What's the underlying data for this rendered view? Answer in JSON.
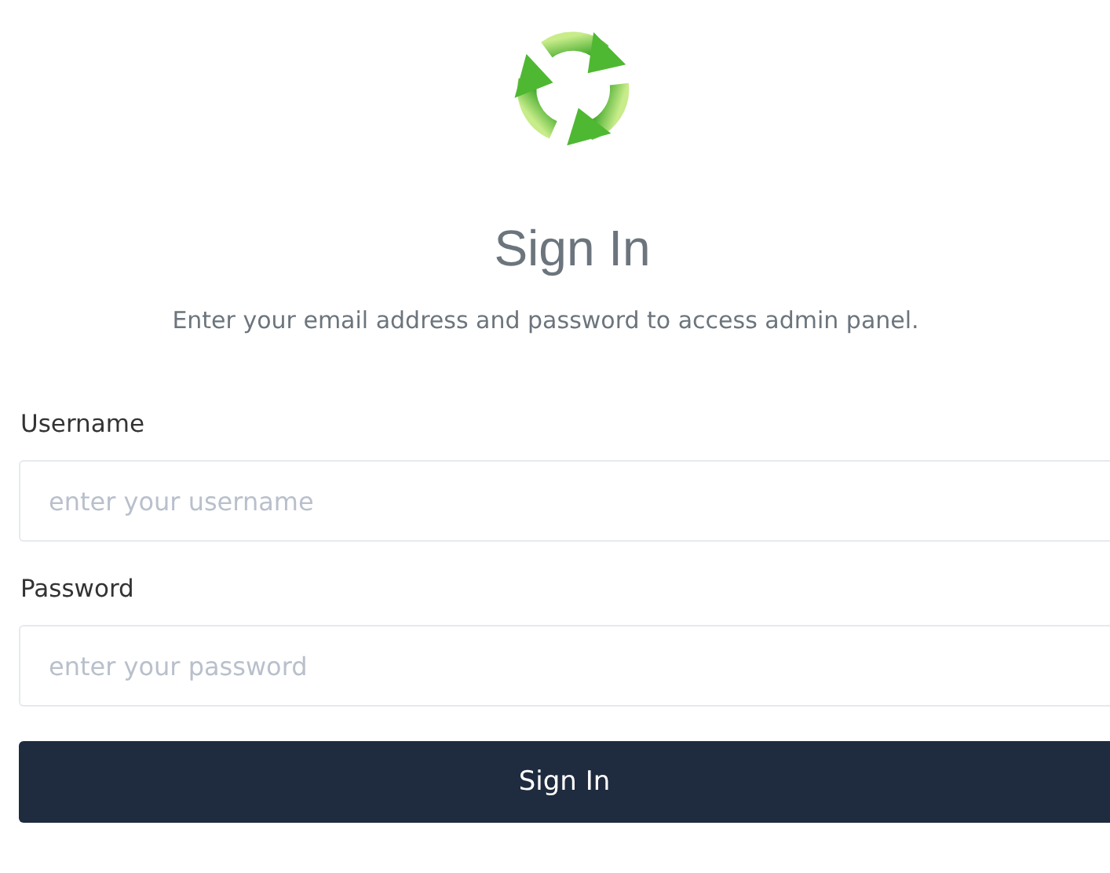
{
  "title": "Sign In",
  "subtitle": "Enter your email address and password to access admin panel.",
  "fields": [
    {
      "label": "Username",
      "placeholder": "enter your username"
    },
    {
      "label": "Password",
      "placeholder": "enter your password"
    }
  ],
  "submit_button": "Sign In"
}
